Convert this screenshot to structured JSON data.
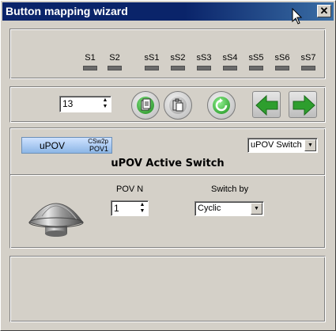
{
  "window": {
    "title": "Button mapping wizard",
    "close_glyph": "✕"
  },
  "switches": [
    "S1",
    "S2",
    "sS1",
    "sS2",
    "sS3",
    "sS4",
    "sS5",
    "sS6",
    "sS7"
  ],
  "toolbar": {
    "button_number": "13",
    "icons": [
      "copy-icon",
      "paste-icon",
      "reset-icon",
      "prev-arrow-icon",
      "next-arrow-icon"
    ]
  },
  "mapping": {
    "upov_button": {
      "label": "uPOV",
      "sub_top": "CSw2p",
      "sub_bottom": "POV1"
    },
    "type_select": "uPOV Switch",
    "heading": "uPOV Active Switch",
    "pov_n_label": "POV N",
    "pov_n_value": "1",
    "switch_by_label": "Switch by",
    "switch_by_value": "Cyclic"
  },
  "colors": {
    "title_bar": "#0a246a",
    "face": "#d4d0c8",
    "green": "#2e9e2e"
  }
}
